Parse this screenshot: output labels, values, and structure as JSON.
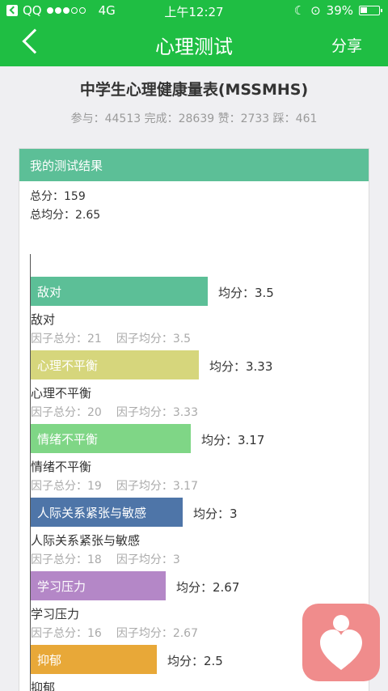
{
  "status_bar": {
    "carrier": "QQ",
    "network": "4G",
    "time": "上午12:27",
    "battery": "39%"
  },
  "nav": {
    "title": "心理测试",
    "share": "分享"
  },
  "test": {
    "title": "中学生心理健康量表(MSSMHS)",
    "stats": "参与：44513 完成：28639 赞：2733 踩：461"
  },
  "result": {
    "header": "我的测试结果",
    "total": "总分：159",
    "avg": "总均分：2.65"
  },
  "factors": [
    {
      "label": "敌对",
      "avg_text": "均分：3.5",
      "avg": 3.5,
      "total_text": "因子总分：21",
      "avg_detail": "因子均分：3.5",
      "color": "#5cbf97"
    },
    {
      "label": "心理不平衡",
      "avg_text": "均分：3.33",
      "avg": 3.33,
      "total_text": "因子总分：20",
      "avg_detail": "因子均分：3.33",
      "color": "#d6d67c"
    },
    {
      "label": "情绪不平衡",
      "avg_text": "均分：3.17",
      "avg": 3.17,
      "total_text": "因子总分：19",
      "avg_detail": "因子均分：3.17",
      "color": "#7fd686"
    },
    {
      "label": "人际关系紧张与敏感",
      "avg_text": "均分：3",
      "avg": 3,
      "total_text": "因子总分：18",
      "avg_detail": "因子均分：3",
      "color": "#4e75a8"
    },
    {
      "label": "学习压力",
      "avg_text": "均分：2.67",
      "avg": 2.67,
      "total_text": "因子总分：16",
      "avg_detail": "因子均分：2.67",
      "color": "#b487c7"
    },
    {
      "label": "抑郁",
      "avg_text": "均分：2.5",
      "avg": 2.5,
      "total_text": "",
      "avg_detail": "",
      "color": "#e8a838"
    }
  ]
}
